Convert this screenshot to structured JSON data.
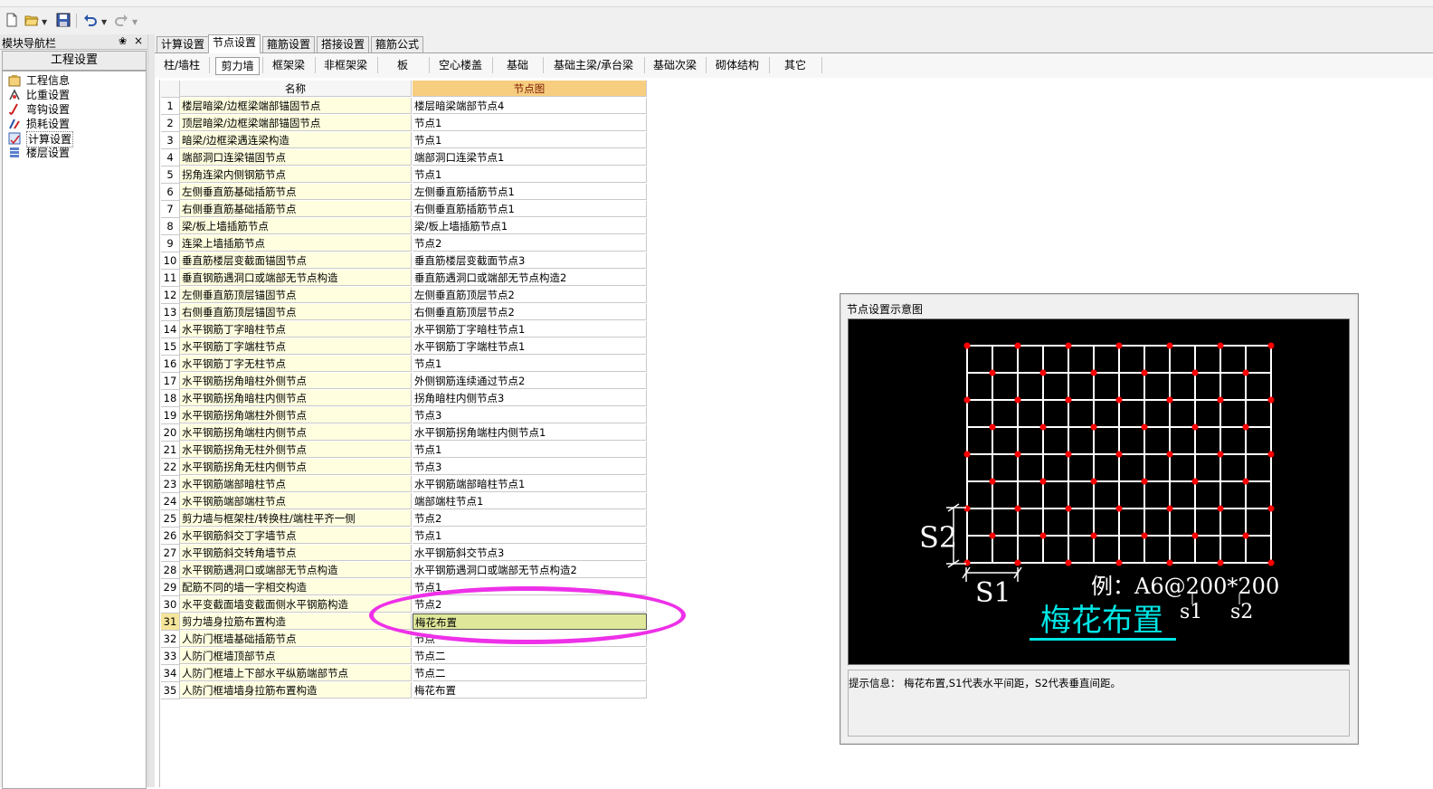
{
  "nav": {
    "title": "模块导航栏",
    "pin": "❀",
    "close": "×",
    "group": "工程设置",
    "items": [
      {
        "label": "工程信息"
      },
      {
        "label": "比重设置"
      },
      {
        "label": "弯钩设置"
      },
      {
        "label": "损耗设置"
      },
      {
        "label": "计算设置"
      },
      {
        "label": "楼层设置"
      }
    ]
  },
  "tabs": [
    "计算设置",
    "节点设置",
    "箍筋设置",
    "搭接设置",
    "箍筋公式"
  ],
  "subtabs": [
    "柱/墙柱",
    "剪力墙",
    "框架梁",
    "非框架梁",
    "板",
    "空心楼盖",
    "基础",
    "基础主梁/承台梁",
    "基础次梁",
    "砌体结构",
    "其它"
  ],
  "grid": {
    "headers": [
      "名称",
      "节点图"
    ],
    "rows": [
      [
        "1",
        "楼层暗梁/边框梁端部锚固节点",
        "楼层暗梁端部节点4"
      ],
      [
        "2",
        "顶层暗梁/边框梁端部锚固节点",
        "节点1"
      ],
      [
        "3",
        "暗梁/边框梁遇连梁构造",
        "节点1"
      ],
      [
        "4",
        "端部洞口连梁锚固节点",
        "端部洞口连梁节点1"
      ],
      [
        "5",
        "拐角连梁内侧钢筋节点",
        "节点1"
      ],
      [
        "6",
        "左侧垂直筋基础插筋节点",
        "左侧垂直筋插筋节点1"
      ],
      [
        "7",
        "右侧垂直筋基础插筋节点",
        "右侧垂直筋插筋节点1"
      ],
      [
        "8",
        "梁/板上墙插筋节点",
        "梁/板上墙插筋节点1"
      ],
      [
        "9",
        "连梁上墙插筋节点",
        "节点2"
      ],
      [
        "10",
        "垂直筋楼层变截面锚固节点",
        "垂直筋楼层变截面节点3"
      ],
      [
        "11",
        "垂直钢筋遇洞口或端部无节点构造",
        "垂直筋遇洞口或端部无节点构造2"
      ],
      [
        "12",
        "左侧垂直筋顶层锚固节点",
        "左侧垂直筋顶层节点2"
      ],
      [
        "13",
        "右侧垂直筋顶层锚固节点",
        "右侧垂直筋顶层节点2"
      ],
      [
        "14",
        "水平钢筋丁字暗柱节点",
        "水平钢筋丁字暗柱节点1"
      ],
      [
        "15",
        "水平钢筋丁字端柱节点",
        "水平钢筋丁字端柱节点1"
      ],
      [
        "16",
        "水平钢筋丁字无柱节点",
        "节点1"
      ],
      [
        "17",
        "水平钢筋拐角暗柱外侧节点",
        "外侧钢筋连续通过节点2"
      ],
      [
        "18",
        "水平钢筋拐角暗柱内侧节点",
        "拐角暗柱内侧节点3"
      ],
      [
        "19",
        "水平钢筋拐角端柱外侧节点",
        "节点3"
      ],
      [
        "20",
        "水平钢筋拐角端柱内侧节点",
        "水平钢筋拐角端柱内侧节点1"
      ],
      [
        "21",
        "水平钢筋拐角无柱外侧节点",
        "节点1"
      ],
      [
        "22",
        "水平钢筋拐角无柱内侧节点",
        "节点3"
      ],
      [
        "23",
        "水平钢筋端部暗柱节点",
        "水平钢筋端部暗柱节点1"
      ],
      [
        "24",
        "水平钢筋端部端柱节点",
        "端部端柱节点1"
      ],
      [
        "25",
        "剪力墙与框架柱/转换柱/端柱平齐一侧",
        "节点2"
      ],
      [
        "26",
        "水平钢筋斜交丁字墙节点",
        "节点1"
      ],
      [
        "27",
        "水平钢筋斜交转角墙节点",
        "水平钢筋斜交节点3"
      ],
      [
        "28",
        "水平钢筋遇洞口或端部无节点构造",
        "水平钢筋遇洞口或端部无节点构造2"
      ],
      [
        "29",
        "配筋不同的墙一字相交构造",
        "节点1"
      ],
      [
        "30",
        "水平变截面墙变截面侧水平钢筋构造",
        "节点2"
      ],
      [
        "31",
        "剪力墙身拉筋布置构造",
        "梅花布置"
      ],
      [
        "32",
        "人防门框墙基础插筋节点",
        "节点一"
      ],
      [
        "33",
        "人防门框墙顶部节点",
        "节点二"
      ],
      [
        "34",
        "人防门框墙上下部水平纵筋端部节点",
        "节点二"
      ],
      [
        "35",
        "人防门框墙墙身拉筋布置构造",
        "梅花布置"
      ]
    ]
  },
  "diagram": {
    "window_title": "节点设置示意图",
    "label_s2": "S2",
    "label_s1": "S1",
    "example": "例：A6@200*200",
    "sub_s1": "s1",
    "sub_s2": "s2",
    "caption": "梅花布置",
    "info": "提示信息：  梅花布置,S1代表水平间距，S2代表垂直间距。",
    "colors": {
      "grid": "#ffffff",
      "dot": "#ff0000",
      "caption": "#00e5e5",
      "background": "#000000"
    }
  }
}
